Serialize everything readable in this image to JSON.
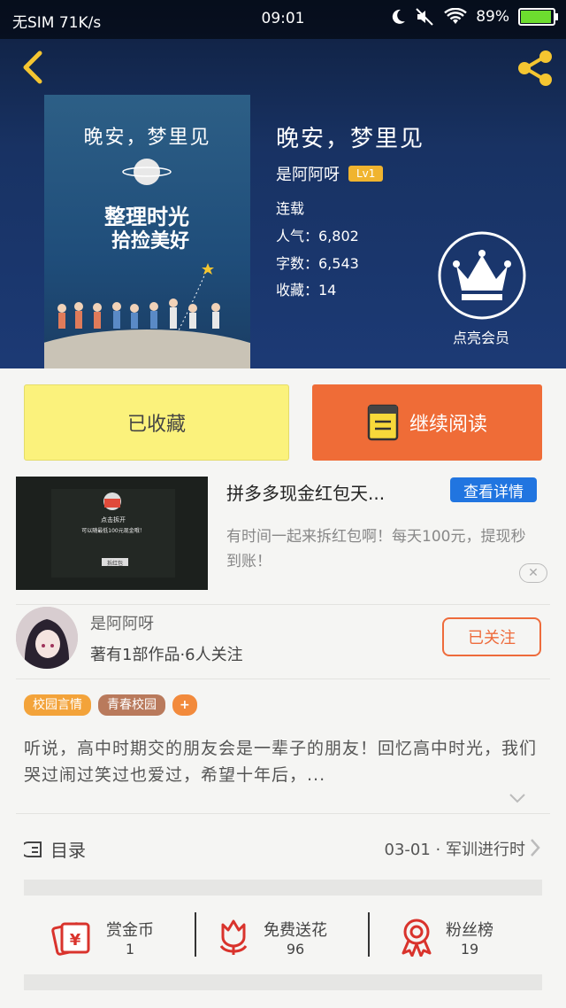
{
  "status_bar": {
    "carrier": "无SIM 71K/s",
    "time": "09:01",
    "battery": "89%",
    "battery_level": 0.89
  },
  "book": {
    "title": "晚安，梦里见",
    "cover_title": "晚安，梦里见",
    "cover_subtitle": "整理时光 拾捡美好",
    "author": "是阿阿呀",
    "level": "Lv1",
    "status": "连载",
    "popularity_label": "人气：6,802",
    "word_count_label": "字数：6,543",
    "collections_label": "收藏：14",
    "vip_label": "点亮会员"
  },
  "actions": {
    "collected_label": "已收藏",
    "continue_label": "继续阅读"
  },
  "ad": {
    "title": "拼多多现金红包天...",
    "detail_button": "查看详情",
    "description": "有时间一起来拆红包啊！每天100元，提现秒到账！",
    "thumb_text_1": "点击拆开",
    "thumb_text_2": "可以随最低100元现金哦！",
    "thumb_button": "拆红包"
  },
  "author_section": {
    "name": "是阿阿呀",
    "meta": "著有1部作品·6人关注",
    "follow_label": "已关注"
  },
  "tags": [
    "校园言情",
    "青春校园",
    "+"
  ],
  "synopsis": "听说，高中时期交的朋友会是一辈子的朋友！回忆高中时光，我们哭过闹过笑过也爱过，希望十年后，...",
  "toc": {
    "label": "目录",
    "latest": "03-01 · 军训进行时"
  },
  "bottom_actions": [
    {
      "label": "赏金币",
      "count": "1",
      "icon": "coin-envelope-icon"
    },
    {
      "label": "免费送花",
      "count": "96",
      "icon": "flower-icon"
    },
    {
      "label": "粉丝榜",
      "count": "19",
      "icon": "medal-icon"
    }
  ],
  "colors": {
    "header_bg": "#183263",
    "collected_bg": "#fbf27c",
    "continue_bg": "#ef6c37",
    "detail_blue": "#2175e0",
    "accent_orange": "#ee6b3b",
    "level_badge": "#f0b42f"
  }
}
